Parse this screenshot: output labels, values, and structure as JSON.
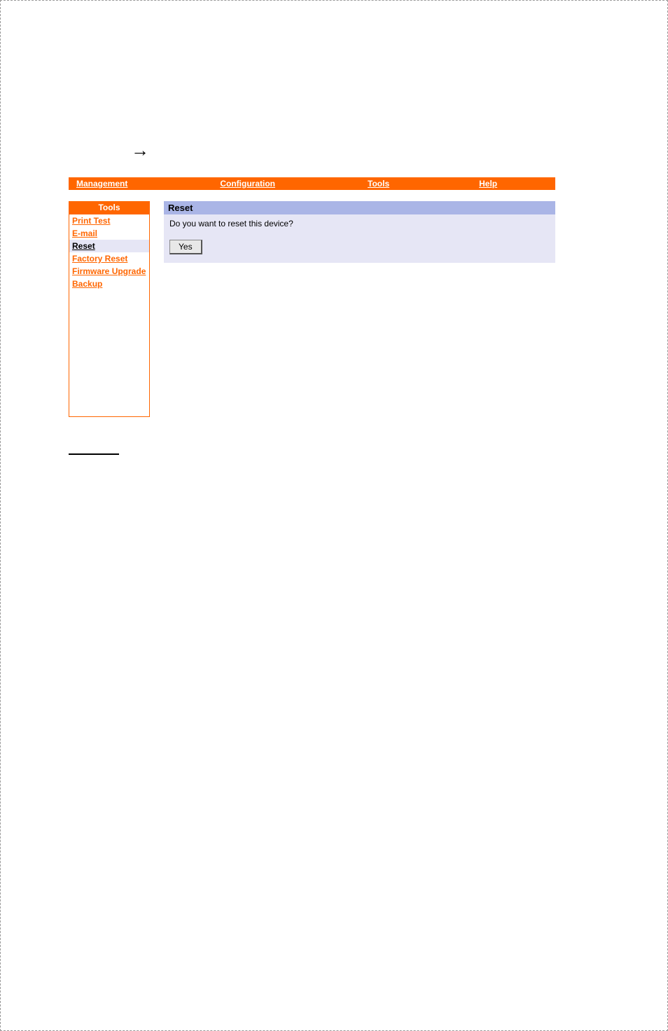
{
  "arrow_glyph": "→",
  "topnav": {
    "items": [
      {
        "label": "Management"
      },
      {
        "label": "Configuration"
      },
      {
        "label": "Tools"
      },
      {
        "label": "Help"
      }
    ]
  },
  "sidebar": {
    "title": "Tools",
    "items": [
      {
        "label": "Print Test",
        "active": false
      },
      {
        "label": "E-mail",
        "active": false
      },
      {
        "label": "Reset",
        "active": true
      },
      {
        "label": "Factory Reset",
        "active": false
      },
      {
        "label": "Firmware Upgrade",
        "active": false
      },
      {
        "label": "Backup",
        "active": false
      }
    ]
  },
  "content": {
    "title": "Reset",
    "message": "Do you want to reset this device?",
    "yes_label": "Yes"
  }
}
